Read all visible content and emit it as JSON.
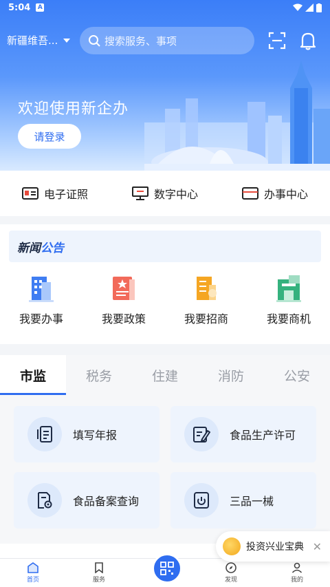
{
  "status_bar": {
    "time": "5:04",
    "badge": "A"
  },
  "header": {
    "region": "新疆维吾...",
    "search_placeholder": "搜索服务、事项"
  },
  "hero": {
    "welcome": "欢迎使用新企办",
    "login_button": "请登录"
  },
  "quick_links": [
    {
      "label": "电子证照",
      "icon": "id-card-icon"
    },
    {
      "label": "数字中心",
      "icon": "monitor-icon"
    },
    {
      "label": "办事中心",
      "icon": "wallet-icon"
    }
  ],
  "news": {
    "title_part1": "新闻",
    "title_part2": "公告"
  },
  "services": [
    {
      "label": "我要办事",
      "icon": "office-building-icon",
      "color": "#3f7df2"
    },
    {
      "label": "我要政策",
      "icon": "policy-book-icon",
      "color": "#f26a5a"
    },
    {
      "label": "我要招商",
      "icon": "investment-building-icon",
      "color": "#f5a623"
    },
    {
      "label": "我要商机",
      "icon": "business-building-icon",
      "color": "#35b27e"
    }
  ],
  "tabs": [
    {
      "label": "市监",
      "active": true
    },
    {
      "label": "税务",
      "active": false
    },
    {
      "label": "住建",
      "active": false
    },
    {
      "label": "消防",
      "active": false
    },
    {
      "label": "公安",
      "active": false
    }
  ],
  "cards": [
    {
      "label": "填写年报",
      "icon": "report-icon"
    },
    {
      "label": "食品生产许可",
      "icon": "edit-doc-icon"
    },
    {
      "label": "食品备案查询",
      "icon": "doc-search-icon"
    },
    {
      "label": "三品一械",
      "icon": "power-box-icon"
    }
  ],
  "promo": {
    "label": "投资兴业宝典"
  },
  "bottom_nav": [
    {
      "label": "首页",
      "icon": "home-icon",
      "active": true
    },
    {
      "label": "服务",
      "icon": "bookmark-icon",
      "active": false
    },
    {
      "label": "",
      "icon": "qr-code-icon",
      "active": false
    },
    {
      "label": "发现",
      "icon": "compass-icon",
      "active": false
    },
    {
      "label": "我的",
      "icon": "user-icon",
      "active": false
    }
  ],
  "colors": {
    "primary": "#2f6df0",
    "hero_top": "#3b7ef8",
    "card_bg": "#eef4fd"
  }
}
